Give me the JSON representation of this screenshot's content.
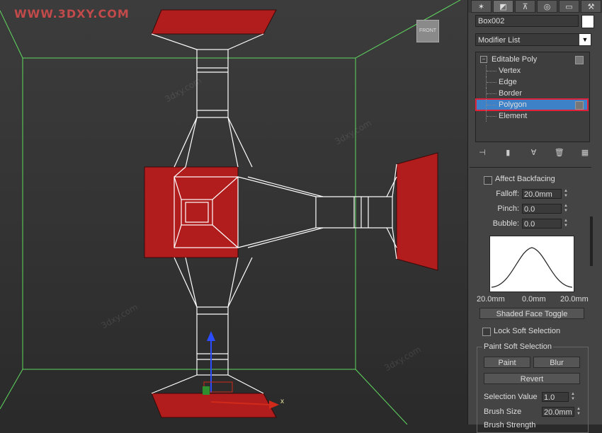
{
  "watermark": {
    "top_left": "WWW.3DXY.COM",
    "diagonal": "3dxy.com"
  },
  "viewport": {
    "viewcube_label": "FRONT",
    "gizmo": {
      "x_label": "x"
    }
  },
  "command_panel": {
    "tabs": [
      "create",
      "modify",
      "hierarchy",
      "motion",
      "display",
      "utilities"
    ],
    "object_name": "Box002",
    "object_color": "#ffffff",
    "modifier_list": "Modifier List",
    "stack": {
      "root": "Editable Poly",
      "items": [
        "Vertex",
        "Edge",
        "Border",
        "Polygon",
        "Element"
      ],
      "selected": "Polygon"
    },
    "stack_tools": [
      "pin-stack",
      "show-end-result",
      "make-unique",
      "remove-modifier",
      "configure-sets"
    ],
    "soft_selection": {
      "affect_backfacing": "Affect Backfacing",
      "falloff_label": "Falloff:",
      "falloff_value": "20.0mm",
      "pinch_label": "Pinch:",
      "pinch_value": "0.0",
      "bubble_label": "Bubble:",
      "bubble_value": "0.0",
      "curve_left": "20.0mm",
      "curve_mid": "0.0mm",
      "curve_right": "20.0mm",
      "shaded_face_toggle": "Shaded Face Toggle",
      "lock_soft_selection": "Lock Soft Selection",
      "paint_group": "Paint Soft Selection",
      "paint": "Paint",
      "blur": "Blur",
      "revert": "Revert",
      "selection_value_label": "Selection Value",
      "selection_value": "1.0",
      "brush_size_label": "Brush Size",
      "brush_size_value": "20.0mm",
      "brush_strength_label": "Brush Strength"
    }
  },
  "colors": {
    "wire": "#ffffff",
    "face": "#b11c1c",
    "frame": "#5fd85f",
    "selected": "#3d82c8",
    "highlight": "#e0213a"
  }
}
